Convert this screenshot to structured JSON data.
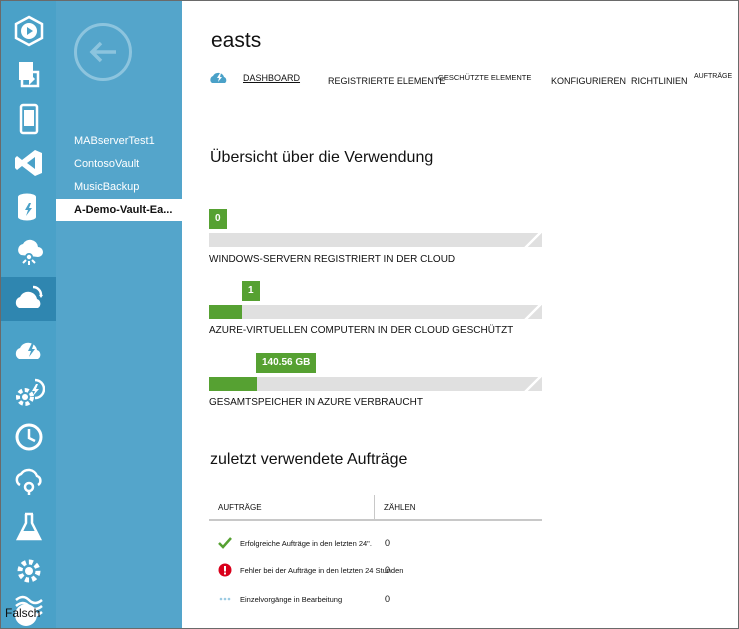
{
  "rail": {
    "items": [
      {
        "name": "media-services-icon"
      },
      {
        "name": "import-export-icon"
      },
      {
        "name": "mobile-services-icon"
      },
      {
        "name": "visual-studio-icon"
      },
      {
        "name": "storage-icon"
      },
      {
        "name": "hdinsight-icon"
      },
      {
        "name": "recovery-services-icon",
        "active": true
      },
      {
        "name": "backup-cloud-icon"
      },
      {
        "name": "automation-icon"
      },
      {
        "name": "scheduler-icon"
      },
      {
        "name": "cloud-services-icon"
      },
      {
        "name": "machine-learning-icon"
      },
      {
        "name": "settings-icon"
      },
      {
        "name": "traffic-manager-icon"
      }
    ],
    "bottom_label": "Falsch"
  },
  "vaults": {
    "items": [
      "MABserverTest1",
      "ContosoVault",
      "MusicBackup",
      "A-Demo-Vault-Ea..."
    ],
    "selected_index": 3
  },
  "header": {
    "title": "easts",
    "tabs": [
      "DASHBOARD",
      "REGISTRIERTE ELEMENTE",
      "GESCHÜTZTE ELEMENTE",
      "KONFIGURIEREN",
      "RICHTLINIEN",
      "AUFTRÄGE"
    ],
    "active_tab": 0
  },
  "usage": {
    "heading": "Übersicht über die Verwendung",
    "bars": [
      {
        "value": "0",
        "fraction": 0.0,
        "label": "WINDOWS-SERVERN REGISTRIERT IN DER CLOUD"
      },
      {
        "value": "1",
        "fraction": 0.1,
        "label": "AZURE-VIRTUELLEN COMPUTERN IN DER CLOUD GESCHÜTZT"
      },
      {
        "value": "140.56 GB",
        "fraction": 0.145,
        "label": "GESAMTSPEICHER IN AZURE VERBRAUCHT"
      }
    ]
  },
  "jobs": {
    "heading": "zuletzt verwendete Aufträge",
    "col_jobs": "AUFTRÄGE",
    "col_count": "ZÄHLEN",
    "rows": [
      {
        "icon": "success-check-icon",
        "text": "Erfolgreiche Aufträge in den letzten 24\".",
        "count": "0"
      },
      {
        "icon": "error-icon",
        "text": "Fehler bei der Aufträge in den letzten 24 Stunden",
        "count": "0"
      },
      {
        "icon": "in-progress-icon",
        "text": "Einzelvorgänge in Bearbeitung",
        "count": "0"
      }
    ]
  },
  "colors": {
    "rail": "#4aa1c8",
    "rail_active": "#2f86b0",
    "vault_panel": "#54a5cb",
    "bar_fill": "#56a132",
    "bar_track": "#e0e0e0",
    "error": "#d9001b"
  }
}
